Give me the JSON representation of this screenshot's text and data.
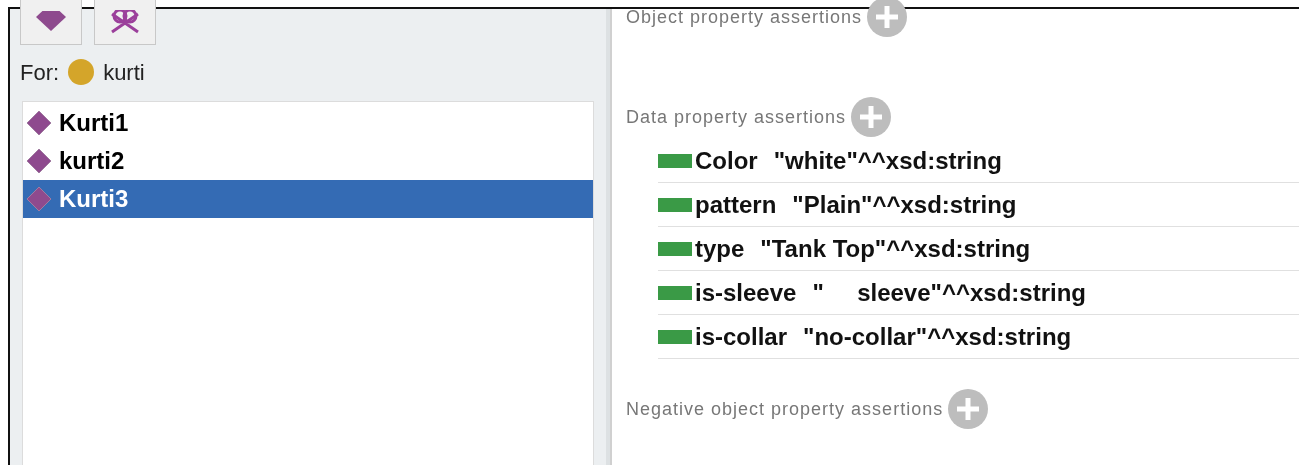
{
  "toolbar": [
    {
      "kind": "individual"
    },
    {
      "kind": "same-as"
    }
  ],
  "for_label": "For:",
  "class_name": "kurti",
  "individuals": [
    {
      "name": "Kurti1",
      "selected": false
    },
    {
      "name": "kurti2",
      "selected": false
    },
    {
      "name": "Kurti3",
      "selected": true
    }
  ],
  "sections": [
    {
      "title": "Object property assertions"
    },
    {
      "title": "Data property assertions",
      "items": [
        {
          "property": "Color",
          "value": "\"white\"^^xsd:string"
        },
        {
          "property": "pattern",
          "value": "\"Plain\"^^xsd:string"
        },
        {
          "property": "type",
          "value": "\"Tank Top\"^^xsd:string"
        },
        {
          "property": "is-sleeve",
          "value": "\"     sleeve\"^^xsd:string"
        },
        {
          "property": "is-collar",
          "value": "\"no-collar\"^^xsd:string"
        }
      ]
    },
    {
      "title": "Negative object property assertions"
    }
  ]
}
